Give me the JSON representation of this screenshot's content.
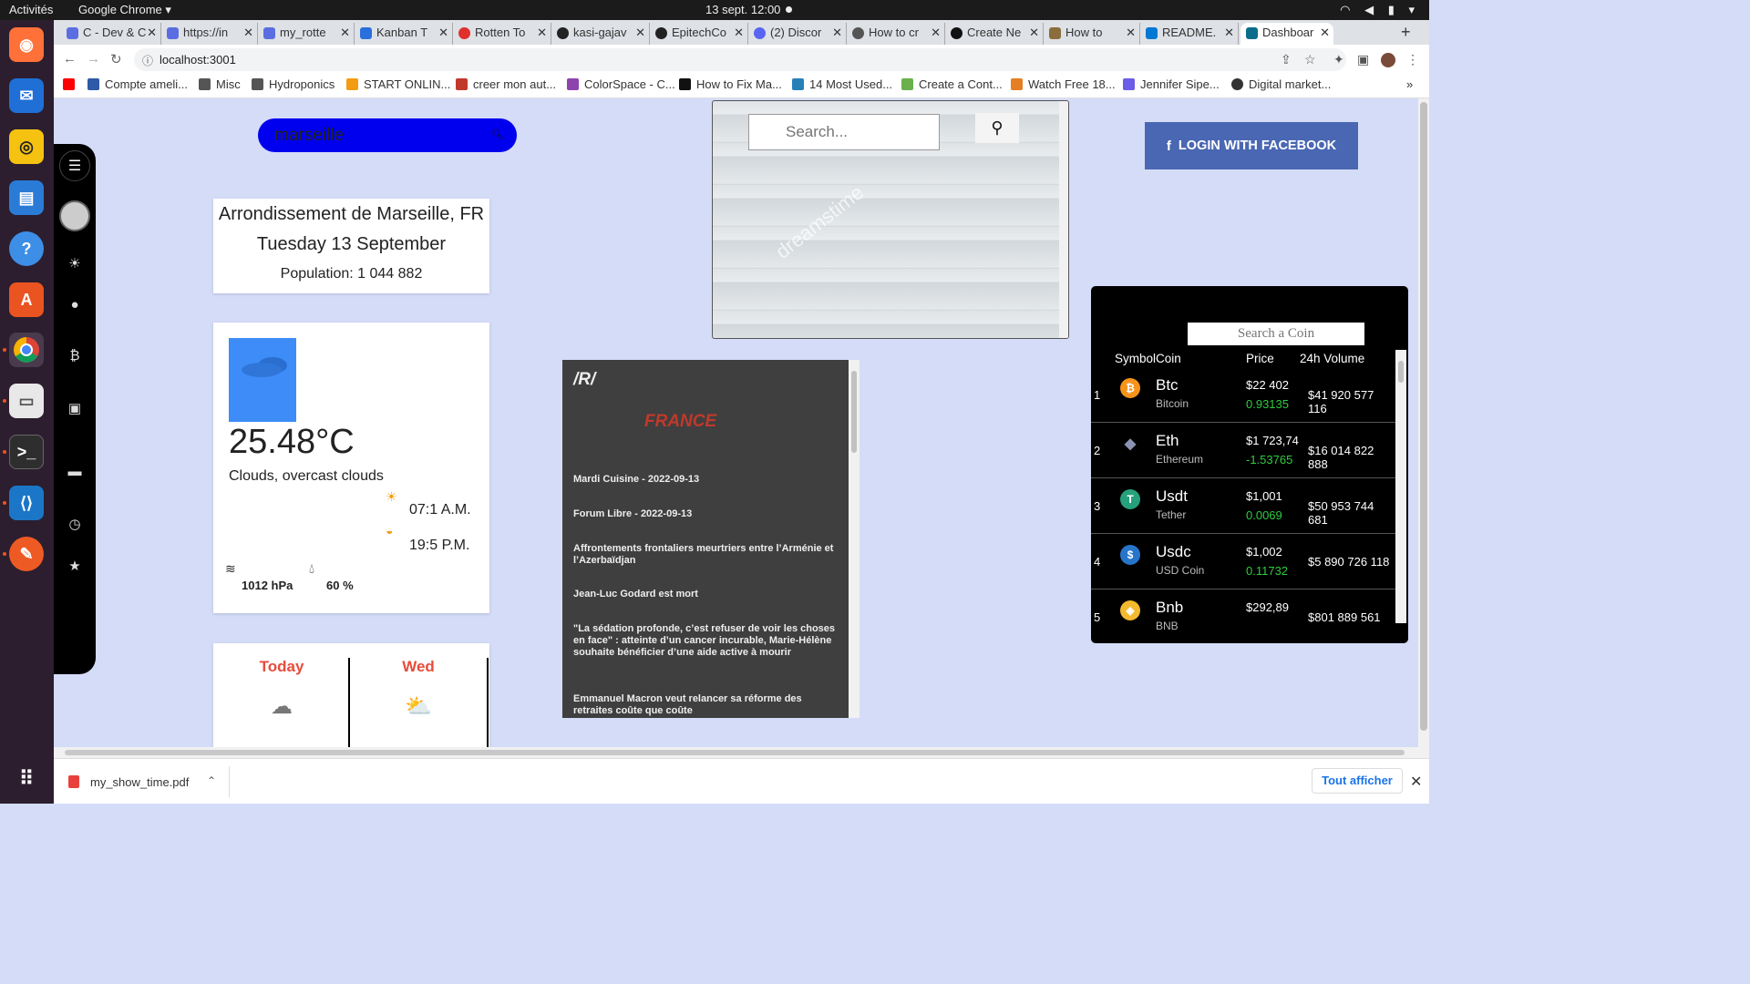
{
  "topbar": {
    "activities": "Activités",
    "app": "Google Chrome ▾",
    "clock": "13 sept.  12:00",
    "tray": "▾ ◀) ▮ ▾"
  },
  "tabs": [
    {
      "label": "C - Dev & C",
      "color": "#5b6ee1"
    },
    {
      "label": "https://in",
      "color": "#5b6ee1"
    },
    {
      "label": "my_rotte",
      "color": "#5b6ee1"
    },
    {
      "label": "Kanban T",
      "color": "#2a6fdb"
    },
    {
      "label": "Rotten To",
      "color": "#e0302b"
    },
    {
      "label": "kasi-gajav",
      "color": "#222222"
    },
    {
      "label": "EpitechCo",
      "color": "#222222"
    },
    {
      "label": "(2) Discor",
      "color": "#5865f2"
    },
    {
      "label": "How to cr",
      "color": "#555555"
    },
    {
      "label": "Create Ne",
      "color": "#111111"
    },
    {
      "label": "How to",
      "color": "#8a6d3b"
    },
    {
      "label": "README.",
      "color": "#0078d4"
    },
    {
      "label": "Dashboar",
      "color": "#0a6e8a",
      "active": true
    }
  ],
  "address": {
    "url": "localhost:3001"
  },
  "bookmarks": [
    {
      "label": "",
      "color": "#ff0000"
    },
    {
      "label": "Compte ameli...",
      "color": "#2e5aa8"
    },
    {
      "label": "Misc",
      "color": "#555555"
    },
    {
      "label": "Hydroponics",
      "color": "#555555"
    },
    {
      "label": "START ONLIN...",
      "color": "#f39c12"
    },
    {
      "label": "creer mon aut...",
      "color": "#c0392b"
    },
    {
      "label": "ColorSpace - C...",
      "color": "#8e44ad"
    },
    {
      "label": "How to Fix Ma...",
      "color": "#111111"
    },
    {
      "label": "14 Most Used...",
      "color": "#2980b9"
    },
    {
      "label": "Create a Cont...",
      "color": "#6ab04c"
    },
    {
      "label": "Watch Free 18...",
      "color": "#e67e22"
    },
    {
      "label": "Jennifer Sipe...",
      "color": "#6c5ce7"
    },
    {
      "label": "Digital market...",
      "color": "#333333"
    }
  ],
  "weather": {
    "search_value": "marseille",
    "city": "Arrondissement de Marseille, FR",
    "date": "Tuesday 13 September",
    "population": "Population: 1 044 882",
    "temperature": "25.48°C",
    "description": "Clouds, overcast clouds",
    "sunrise": "07:1 A.M.",
    "sunset": "19:5 P.M.",
    "pressure": "1012 hPa",
    "humidity": "60 %",
    "forecast": [
      {
        "day": "Today",
        "icon": "cloud-icon"
      },
      {
        "day": "Wed",
        "icon": "rain-sun-icon"
      }
    ]
  },
  "image_search": {
    "placeholder": "Search...",
    "watermark": "dreamstime"
  },
  "reddit": {
    "header": "/R/",
    "subreddit": "FRANCE",
    "posts": [
      "Mardi Cuisine - 2022-09-13",
      "Forum Libre - 2022-09-13",
      "Affrontements frontaliers meurtriers entre l’Arménie et l’Azerbaïdjan",
      "Jean-Luc Godard est mort",
      "\"La sédation profonde, c’est refuser de voir les choses en face\" : atteinte d’un cancer incurable, Marie-Hélène souhaite bénéficier d’une aide active à mourir",
      "Emmanuel Macron veut relancer sa réforme des retraites coûte que coûte"
    ]
  },
  "facebook": {
    "label": "LOGIN WITH FACEBOOK"
  },
  "crypto": {
    "placeholder": "Search a Coin",
    "headers": [
      "Symbol",
      "Coin",
      "Price",
      "24h Volume"
    ],
    "coins": [
      {
        "rank": "1",
        "symbol": "Btc",
        "name": "Bitcoin",
        "price": "$22 402",
        "change": "0.93135",
        "volume": "$41 920 577 116",
        "color": "#f7931a",
        "glyph": "₿"
      },
      {
        "rank": "2",
        "symbol": "Eth",
        "name": "Ethereum",
        "price": "$1 723,74",
        "change": "-1.53765",
        "volume": "$16 014 822 888",
        "color": "#000000",
        "glyph": "◆"
      },
      {
        "rank": "3",
        "symbol": "Usdt",
        "name": "Tether",
        "price": "$1,001",
        "change": "0.0069",
        "volume": "$50 953 744 681",
        "color": "#26a17b",
        "glyph": "T"
      },
      {
        "rank": "4",
        "symbol": "Usdc",
        "name": "USD Coin",
        "price": "$1,002",
        "change": "0.11732",
        "volume": "$5 890 726 118",
        "color": "#2775ca",
        "glyph": "$"
      },
      {
        "rank": "5",
        "symbol": "Bnb",
        "name": "BNB",
        "price": "$292,89",
        "change": "",
        "volume": "$801 889 561",
        "color": "#f3ba2f",
        "glyph": "◈"
      }
    ]
  },
  "downloads": {
    "file": "my_show_time.pdf",
    "show_all": "Tout afficher"
  }
}
